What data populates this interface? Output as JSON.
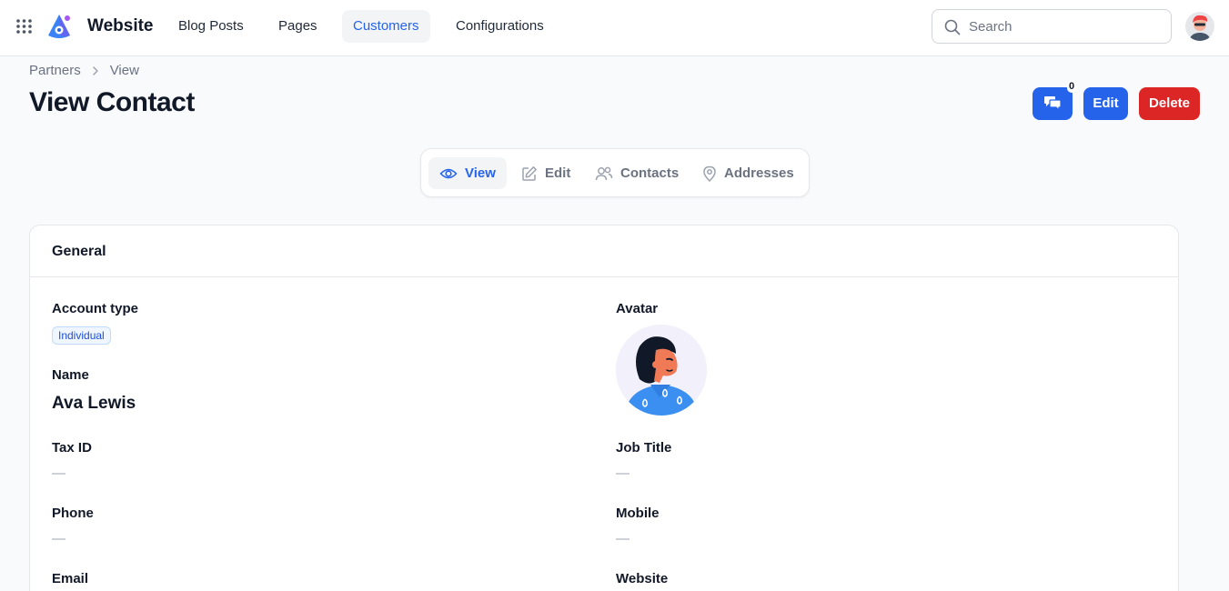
{
  "app": {
    "brand": "Website"
  },
  "nav": [
    {
      "label": "Blog Posts",
      "active": false
    },
    {
      "label": "Pages",
      "active": false
    },
    {
      "label": "Customers",
      "active": true
    },
    {
      "label": "Configurations",
      "active": false
    }
  ],
  "search": {
    "placeholder": "Search",
    "value": ""
  },
  "breadcrumb": {
    "parent": "Partners",
    "current": "View"
  },
  "page": {
    "title": "View Contact"
  },
  "actions": {
    "comments_count": "0",
    "edit": "Edit",
    "delete": "Delete"
  },
  "tabs": [
    {
      "label": "View",
      "icon": "eye-icon",
      "active": true
    },
    {
      "label": "Edit",
      "icon": "pencil-icon",
      "active": false
    },
    {
      "label": "Contacts",
      "icon": "users-icon",
      "active": false
    },
    {
      "label": "Addresses",
      "icon": "map-pin-icon",
      "active": false
    }
  ],
  "general": {
    "title": "General",
    "account_type_label": "Account type",
    "account_type_value": "Individual",
    "avatar_label": "Avatar",
    "name_label": "Name",
    "name_value": "Ava Lewis",
    "tax_id_label": "Tax ID",
    "tax_id_value": "—",
    "job_title_label": "Job Title",
    "job_title_value": "—",
    "phone_label": "Phone",
    "phone_value": "—",
    "mobile_label": "Mobile",
    "mobile_value": "—",
    "email_label": "Email",
    "website_label": "Website"
  },
  "colors": {
    "primary": "#2563eb",
    "danger": "#dc2626",
    "border": "#e5e7eb",
    "background": "#f9fafb"
  }
}
